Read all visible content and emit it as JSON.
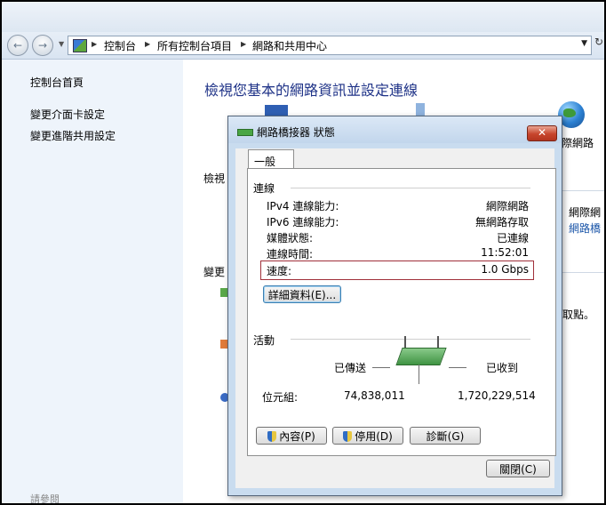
{
  "address": {
    "crumbs": [
      "控制台",
      "所有控制台項目",
      "網路和共用中心"
    ]
  },
  "left_pane": {
    "items": [
      "控制台首頁",
      "變更介面卡設定",
      "變更進階共用設定"
    ],
    "bottom": "請參閱"
  },
  "main": {
    "title": "檢視您基本的網路資訊並設定連線",
    "frag_network": "際網路",
    "frag_view": "檢視",
    "frag_change": "變更",
    "frag_right1": "網際網",
    "frag_right2": "網路橋",
    "frag_access": "取點。"
  },
  "dialog": {
    "title": "網路橋接器 狀態",
    "close_label": "✕",
    "tab": "一般",
    "connection": {
      "header": "連線",
      "rows": [
        {
          "label": "IPv4 連線能力:",
          "value": "網際網路"
        },
        {
          "label": "IPv6 連線能力:",
          "value": "無網路存取"
        },
        {
          "label": "媒體狀態:",
          "value": "已連線"
        },
        {
          "label": "連線時間:",
          "value": "11:52:01"
        },
        {
          "label": "速度:",
          "value": "1.0 Gbps"
        }
      ],
      "details_button": "詳細資料(E)..."
    },
    "activity": {
      "header": "活動",
      "sent_label": "已傳送",
      "received_label": "已收到",
      "bytes_label": "位元組:",
      "sent_bytes": "74,838,011",
      "received_bytes": "1,720,229,514"
    },
    "buttons": {
      "properties": "內容(P)",
      "disable": "停用(D)",
      "diagnose": "診斷(G)",
      "close": "關閉(C)"
    }
  },
  "colors": {
    "title_blue": "#1e3287",
    "left_pane_bg": "#eef4fb",
    "dialog_frame": "#c9dcef",
    "speed_highlight": "#a0303a"
  }
}
